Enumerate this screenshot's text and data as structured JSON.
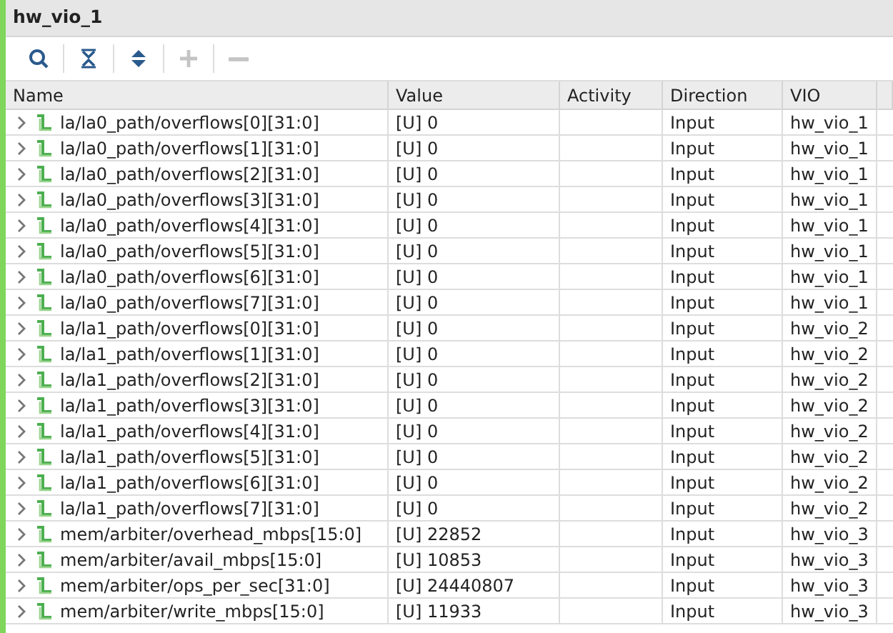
{
  "window": {
    "title": "hw_vio_1"
  },
  "toolbar": [
    {
      "kind": "search",
      "disabled": false
    },
    {
      "kind": "collapse",
      "disabled": false
    },
    {
      "kind": "expand",
      "disabled": false
    },
    {
      "kind": "add",
      "disabled": true
    },
    {
      "kind": "remove",
      "disabled": true
    }
  ],
  "table": {
    "columns": [
      "Name",
      "Value",
      "Activity",
      "Direction",
      "VIO"
    ],
    "rows": [
      {
        "name": "la/la0_path/overflows[0][31:0]",
        "value": "[U] 0",
        "activity": "",
        "direction": "Input",
        "vio": "hw_vio_1",
        "expanded": false
      },
      {
        "name": "la/la0_path/overflows[1][31:0]",
        "value": "[U] 0",
        "activity": "",
        "direction": "Input",
        "vio": "hw_vio_1",
        "expanded": false
      },
      {
        "name": "la/la0_path/overflows[2][31:0]",
        "value": "[U] 0",
        "activity": "",
        "direction": "Input",
        "vio": "hw_vio_1",
        "expanded": false
      },
      {
        "name": "la/la0_path/overflows[3][31:0]",
        "value": "[U] 0",
        "activity": "",
        "direction": "Input",
        "vio": "hw_vio_1",
        "expanded": false
      },
      {
        "name": "la/la0_path/overflows[4][31:0]",
        "value": "[U] 0",
        "activity": "",
        "direction": "Input",
        "vio": "hw_vio_1",
        "expanded": false
      },
      {
        "name": "la/la0_path/overflows[5][31:0]",
        "value": "[U] 0",
        "activity": "",
        "direction": "Input",
        "vio": "hw_vio_1",
        "expanded": false
      },
      {
        "name": "la/la0_path/overflows[6][31:0]",
        "value": "[U] 0",
        "activity": "",
        "direction": "Input",
        "vio": "hw_vio_1",
        "expanded": false
      },
      {
        "name": "la/la0_path/overflows[7][31:0]",
        "value": "[U] 0",
        "activity": "",
        "direction": "Input",
        "vio": "hw_vio_1",
        "expanded": false
      },
      {
        "name": "la/la1_path/overflows[0][31:0]",
        "value": "[U] 0",
        "activity": "",
        "direction": "Input",
        "vio": "hw_vio_2",
        "expanded": false
      },
      {
        "name": "la/la1_path/overflows[1][31:0]",
        "value": "[U] 0",
        "activity": "",
        "direction": "Input",
        "vio": "hw_vio_2",
        "expanded": false
      },
      {
        "name": "la/la1_path/overflows[2][31:0]",
        "value": "[U] 0",
        "activity": "",
        "direction": "Input",
        "vio": "hw_vio_2",
        "expanded": false
      },
      {
        "name": "la/la1_path/overflows[3][31:0]",
        "value": "[U] 0",
        "activity": "",
        "direction": "Input",
        "vio": "hw_vio_2",
        "expanded": false
      },
      {
        "name": "la/la1_path/overflows[4][31:0]",
        "value": "[U] 0",
        "activity": "",
        "direction": "Input",
        "vio": "hw_vio_2",
        "expanded": false
      },
      {
        "name": "la/la1_path/overflows[5][31:0]",
        "value": "[U] 0",
        "activity": "",
        "direction": "Input",
        "vio": "hw_vio_2",
        "expanded": false
      },
      {
        "name": "la/la1_path/overflows[6][31:0]",
        "value": "[U] 0",
        "activity": "",
        "direction": "Input",
        "vio": "hw_vio_2",
        "expanded": false
      },
      {
        "name": "la/la1_path/overflows[7][31:0]",
        "value": "[U] 0",
        "activity": "",
        "direction": "Input",
        "vio": "hw_vio_2",
        "expanded": false
      },
      {
        "name": "mem/arbiter/overhead_mbps[15:0]",
        "value": "[U] 22852",
        "activity": "",
        "direction": "Input",
        "vio": "hw_vio_3",
        "expanded": false
      },
      {
        "name": "mem/arbiter/avail_mbps[15:0]",
        "value": "[U] 10853",
        "activity": "",
        "direction": "Input",
        "vio": "hw_vio_3",
        "expanded": false
      },
      {
        "name": "mem/arbiter/ops_per_sec[31:0]",
        "value": "[U] 24440807",
        "activity": "",
        "direction": "Input",
        "vio": "hw_vio_3",
        "expanded": false
      },
      {
        "name": "mem/arbiter/write_mbps[15:0]",
        "value": "[U] 11933",
        "activity": "",
        "direction": "Input",
        "vio": "hw_vio_3",
        "expanded": false
      }
    ]
  }
}
